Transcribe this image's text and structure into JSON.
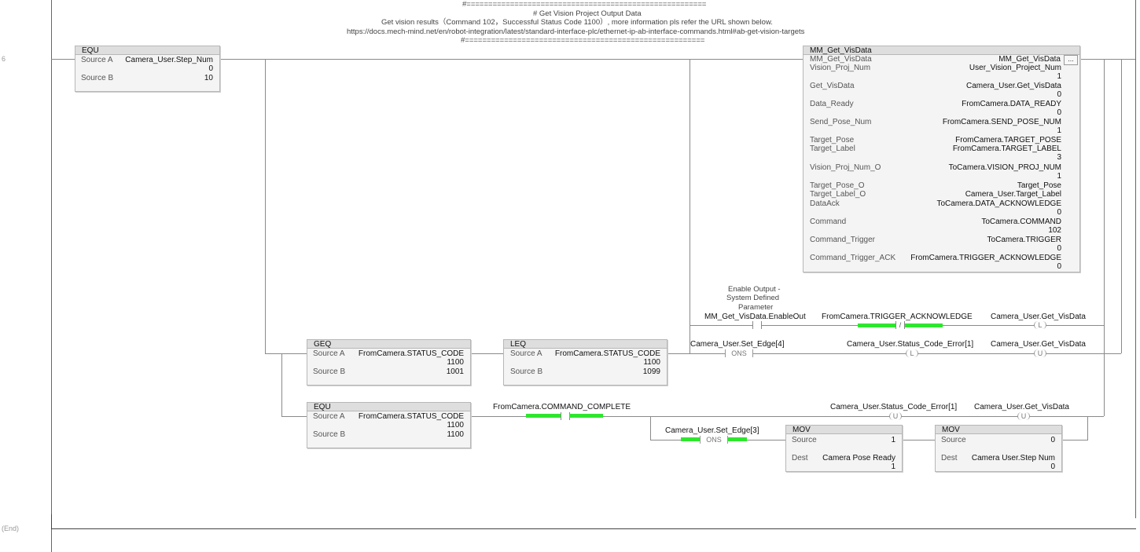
{
  "rung": {
    "number": "6",
    "end_label": "(End)",
    "comment": {
      "line1": "#=======================================================",
      "line2": "# Get Vision Project Output Data",
      "line3": "Get vision results（Command 102，Successful Status Code 1100）, more information pls refer the URL shown below.",
      "line4": "https://docs.mech-mind.net/en/robot-integration/latest/standard-interface-plc/ethernet-ip-ab-interface-commands.html#ab-get-vision-targets",
      "line5": "#======================================================="
    }
  },
  "equ_step": {
    "title": "EQU",
    "source_a_label": "Source A",
    "source_a_tag": "Camera_User.Step_Num",
    "source_a_value": "0",
    "source_b_label": "Source B",
    "source_b_value": "10"
  },
  "aoi": {
    "title": "MM_Get_VisData",
    "ellipsis": "...",
    "rows": [
      {
        "param": "MM_Get_VisData",
        "tag": "MM_Get_VisData",
        "value": ""
      },
      {
        "param": "Vision_Proj_Num",
        "tag": "User_Vision_Project_Num",
        "value": "1"
      },
      {
        "param": "Get_VisData",
        "tag": "Camera_User.Get_VisData",
        "value": "0"
      },
      {
        "param": "Data_Ready",
        "tag": "FromCamera.DATA_READY",
        "value": "0"
      },
      {
        "param": "Send_Pose_Num",
        "tag": "FromCamera.SEND_POSE_NUM",
        "value": "1"
      },
      {
        "param": "Target_Pose",
        "tag": "FromCamera.TARGET_POSE",
        "value": ""
      },
      {
        "param": "Target_Label",
        "tag": "FromCamera.TARGET_LABEL",
        "value": "3"
      },
      {
        "param": "Vision_Proj_Num_O",
        "tag": "ToCamera.VISION_PROJ_NUM",
        "value": "1"
      },
      {
        "param": "Target_Pose_O",
        "tag": "Target_Pose",
        "value": ""
      },
      {
        "param": "Target_Label_O",
        "tag": "Camera_User.Target_Label",
        "value": ""
      },
      {
        "param": "DataAck",
        "tag": "ToCamera.DATA_ACKNOWLEDGE",
        "value": "0"
      },
      {
        "param": "Command",
        "tag": "ToCamera.COMMAND",
        "value": "102"
      },
      {
        "param": "Command_Trigger",
        "tag": "ToCamera.TRIGGER",
        "value": "0"
      },
      {
        "param": "Command_Trigger_ACK",
        "tag": "FromCamera.TRIGGER_ACKNOWLEDGE",
        "value": "0"
      }
    ]
  },
  "branch1": {
    "enable_desc_1": "Enable Output -",
    "enable_desc_2": "System Defined",
    "enable_desc_3": "Parameter",
    "enable_tag": "MM_Get_VisData.EnableOut",
    "trigger_ack_tag": "FromCamera.TRIGGER_ACKNOWLEDGE",
    "trigger_ack_symbol": "/",
    "coil_tag": "Camera_User.Get_VisData",
    "coil_symbol": "L"
  },
  "geq": {
    "title": "GEQ",
    "source_a_label": "Source A",
    "source_a_tag": "FromCamera.STATUS_CODE",
    "source_a_value": "1100",
    "source_b_label": "Source B",
    "source_b_value": "1001"
  },
  "leq": {
    "title": "LEQ",
    "source_a_label": "Source A",
    "source_a_tag": "FromCamera.STATUS_CODE",
    "source_a_value": "1100",
    "source_b_label": "Source B",
    "source_b_value": "1099"
  },
  "branch2": {
    "ons_tag": "Camera_User.Set_Edge[4]",
    "ons_label": "ONS",
    "coil1_tag": "Camera_User.Status_Code_Error[1]",
    "coil1_symbol": "L",
    "coil2_tag": "Camera_User.Get_VisData",
    "coil2_symbol": "U"
  },
  "equ_status": {
    "title": "EQU",
    "source_a_label": "Source A",
    "source_a_tag": "FromCamera.STATUS_CODE",
    "source_a_value": "1100",
    "source_b_label": "Source B",
    "source_b_value": "1100"
  },
  "branch3": {
    "contact_tag": "FromCamera.COMMAND_COMPLETE",
    "coil1_tag": "Camera_User.Status_Code_Error[1]",
    "coil1_symbol": "U",
    "coil2_tag": "Camera_User.Get_VisData",
    "coil2_symbol": "U",
    "ons_tag": "Camera_User.Set_Edge[3]",
    "ons_label": "ONS"
  },
  "mov1": {
    "title": "MOV",
    "source_label": "Source",
    "source_value": "1",
    "dest_label": "Dest",
    "dest_tag": "Camera Pose Ready",
    "dest_value": "1"
  },
  "mov2": {
    "title": "MOV",
    "source_label": "Source",
    "source_value": "0",
    "dest_label": "Dest",
    "dest_tag": "Camera User.Step Num",
    "dest_value": "0"
  },
  "colors": {
    "power_flow": "#2fe62f",
    "wire": "#8a8a8a",
    "block_bg": "#f4f4f4"
  }
}
